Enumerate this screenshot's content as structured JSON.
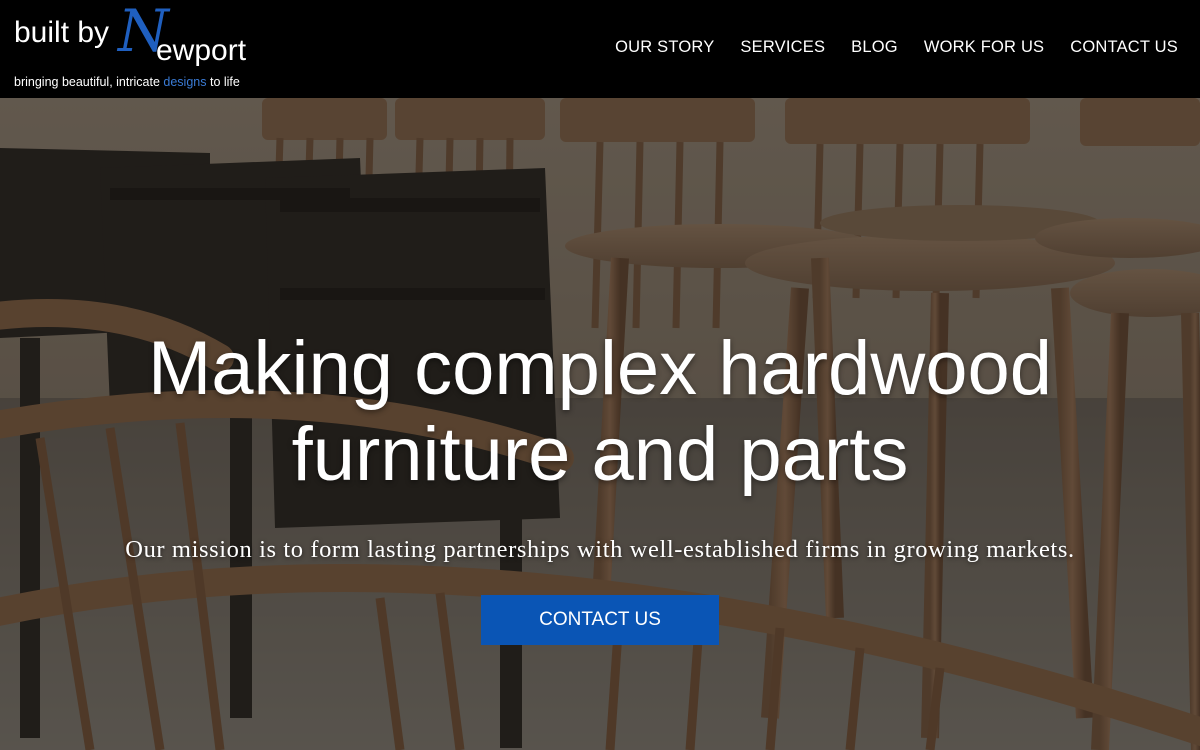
{
  "brand": {
    "logo_prefix": "built by",
    "logo_initial": "N",
    "logo_suffix": "ewport",
    "tagline_before": "bringing beautiful, intricate ",
    "tagline_highlight": "designs",
    "tagline_after": " to life",
    "accent_color": "#1f5fbf"
  },
  "nav": {
    "items": [
      {
        "label": "OUR STORY"
      },
      {
        "label": "SERVICES"
      },
      {
        "label": "BLOG"
      },
      {
        "label": "WORK FOR US"
      },
      {
        "label": "CONTACT US"
      }
    ]
  },
  "hero": {
    "headline_line1": "Making complex hardwood",
    "headline_line2": "furniture and parts",
    "mission": "Our mission is to form lasting partnerships with well-established firms in growing markets.",
    "cta_label": "CONTACT US",
    "cta_color": "#0a55b5"
  }
}
